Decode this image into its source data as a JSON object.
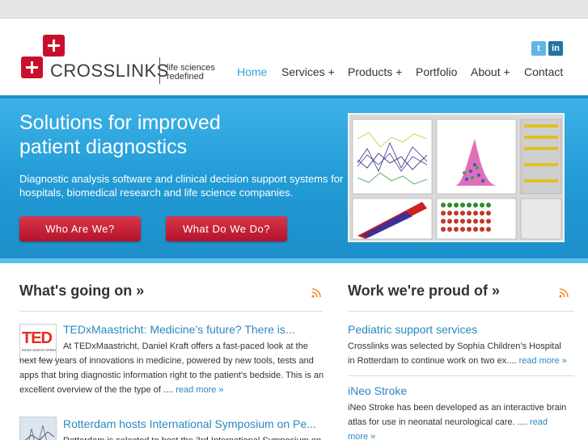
{
  "header": {
    "brand": "CROSSLINKS",
    "tagline_line1": "life sciences",
    "tagline_line2": "redefined",
    "social": {
      "twitter_icon": "t",
      "linkedin_icon": "in"
    },
    "nav": [
      {
        "label": "Home",
        "active": true
      },
      {
        "label": "Services +"
      },
      {
        "label": "Products +"
      },
      {
        "label": "Portfolio"
      },
      {
        "label": "About +"
      },
      {
        "label": "Contact"
      }
    ]
  },
  "hero": {
    "title_line1": "Solutions for improved",
    "title_line2": "patient diagnostics",
    "description": "Diagnostic analysis software and clinical decision support systems for hospitals, biomedical research and life science companies.",
    "button_who": "Who Are We?",
    "button_what": "What Do We Do?"
  },
  "news": {
    "heading": "What's going on »",
    "items": [
      {
        "title": "TEDxMaastricht: Medicine’s future? There is...",
        "text": "At TEDxMaastricht, Daniel Kraft offers a fast-paced look at the next few years of innovations in medicine, powered by new tools, tests and apps that bring diagnostic information right to the patient's bedside. This is an excellent overview of the the type of ....",
        "read_more": "read more »",
        "thumb_logo": "TED",
        "thumb_caption": "IDEAS WORTH SPREADING"
      },
      {
        "title": "Rotterdam hosts International Symposium on Pe...",
        "text": "Rotterdam is selected to host the 3rd International Symposium on"
      }
    ]
  },
  "work": {
    "heading": "Work we're proud of »",
    "items": [
      {
        "title": "Pediatric support services",
        "text": "Crosslinks was selected by Sophia Children’s Hospital in Rotterdam to continue work on two ex....",
        "read_more": "read more »"
      },
      {
        "title": "iNeo Stroke",
        "text": "iNeo Stroke has been developed as an interactive brain atlas for use in neonatal neurological care. ....",
        "read_more": "read more »"
      }
    ]
  },
  "colors": {
    "accent_red": "#c8102e",
    "hero_blue": "#229bd6",
    "link_blue": "#2a88c2",
    "rss_orange": "#f28c28"
  }
}
